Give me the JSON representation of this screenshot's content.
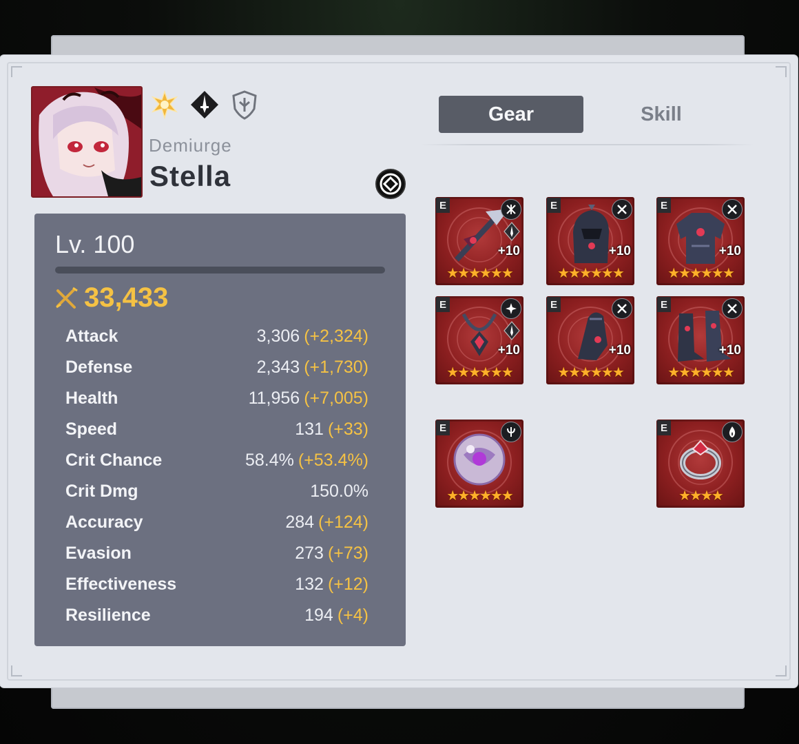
{
  "hero": {
    "class": "Demiurge",
    "name": "Stella",
    "icons": [
      "light-element-icon",
      "assassin-class-icon",
      "zodiac-shield-icon"
    ]
  },
  "stats": {
    "level": "Lv. 100",
    "combat_power": "33,433",
    "rows": [
      {
        "label": "Attack",
        "value": "3,306",
        "bonus": "(+2,324)"
      },
      {
        "label": "Defense",
        "value": "2,343",
        "bonus": "(+1,730)"
      },
      {
        "label": "Health",
        "value": "11,956",
        "bonus": "(+7,005)"
      },
      {
        "label": "Speed",
        "value": "131",
        "bonus": "(+33)"
      },
      {
        "label": "Crit Chance",
        "value": "58.4%",
        "bonus": "(+53.4%)"
      },
      {
        "label": "Crit Dmg",
        "value": "150.0%",
        "bonus": ""
      },
      {
        "label": "Accuracy",
        "value": "284",
        "bonus": "(+124)"
      },
      {
        "label": "Evasion",
        "value": "273",
        "bonus": "(+73)"
      },
      {
        "label": "Effectiveness",
        "value": "132",
        "bonus": "(+12)"
      },
      {
        "label": "Resilience",
        "value": "194",
        "bonus": "(+4)"
      }
    ]
  },
  "tabs": {
    "gear": "Gear",
    "skill": "Skill"
  },
  "gear": [
    {
      "slot": "weapon",
      "grade": "E",
      "enhance": "+10",
      "stars": "★★★★★★",
      "set_icon": "counter-set-icon"
    },
    {
      "slot": "helmet",
      "grade": "E",
      "enhance": "+10",
      "stars": "★★★★★★",
      "set_icon": "crossed-swords-set-icon"
    },
    {
      "slot": "armor",
      "grade": "E",
      "enhance": "+10",
      "stars": "★★★★★★",
      "set_icon": "crossed-swords-set-icon"
    },
    {
      "slot": "necklace",
      "grade": "E",
      "enhance": "+10",
      "stars": "★★★★★★",
      "set_icon": "crit-set-icon"
    },
    {
      "slot": "ring",
      "grade": "E",
      "enhance": "+10",
      "stars": "★★★★★★",
      "set_icon": "crossed-swords-set-icon"
    },
    {
      "slot": "boots",
      "grade": "E",
      "enhance": "+10",
      "stars": "★★★★★★",
      "set_icon": "crossed-swords-set-icon"
    },
    {
      "slot": "artifact-orb",
      "grade": "E",
      "enhance": "",
      "stars": "★★★★★★",
      "set_icon": "trident-icon"
    },
    {
      "slot": "exclusive-ring",
      "grade": "E",
      "enhance": "",
      "stars": "★★★★",
      "set_icon": "flame-icon"
    }
  ],
  "colors": {
    "accent_gold": "#f5c244",
    "stat_panel": "#6c7080",
    "gear_bg": "#8c1f20"
  }
}
